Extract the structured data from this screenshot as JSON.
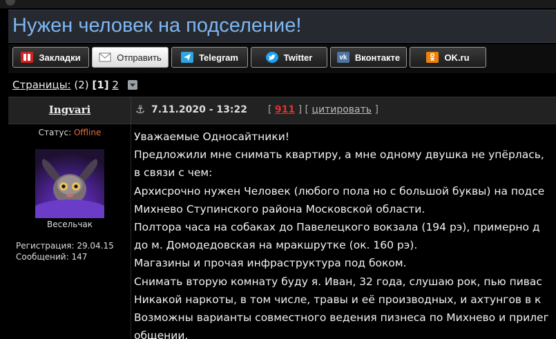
{
  "thread": {
    "title": "Нужен человек на подселение!"
  },
  "share": {
    "buttons": [
      {
        "label": "Закладки",
        "icon": "bookmark-icon",
        "color": "#d42020"
      },
      {
        "label": "Отправить",
        "icon": "envelope-icon",
        "color": "#ffffff"
      },
      {
        "label": "Telegram",
        "icon": "telegram-icon",
        "color": "#2ca5e0"
      },
      {
        "label": "Twitter",
        "icon": "twitter-icon",
        "color": "#1da1f2"
      },
      {
        "label": "Вконтакте",
        "icon": "vk-icon",
        "color": "#4c75a3"
      },
      {
        "label": "OK.ru",
        "icon": "odnoklassniki-icon",
        "color": "#ee8208"
      }
    ]
  },
  "pagination": {
    "label": "Страницы:",
    "count": "(2)",
    "current": "[1]",
    "next": "2"
  },
  "post": {
    "author": "Ingvari",
    "date": "7.11.2020 - 13:22",
    "number": "911",
    "quote_label": "цитировать",
    "status_label": "Статус:",
    "status_value": "Offline",
    "status_color": "#e0703a",
    "rank": "Весельчак",
    "registration": "Регистрация: 29.04.15",
    "messages": "Сообщений: 147",
    "body": [
      "Уважаемые Односайтники!",
      "Предложили мне снимать квартиру, а мне одному двушка не упёрлась,",
      "в связи с чем:",
      "Архисрочно нужен Человек (любого пола но с большой буквы) на подсе",
      "Михнево Ступинского района Московской области.",
      "Полтора часа на собаках до Павелецкого вокзала (194 рэ), примерно д",
      "до м. Домодедовская на мракшрутке (ок. 160 рэ).",
      "Магазины и прочая инфраструктура под боком.",
      "Снимать вторую комнату буду я. Иван, 32 года, слушаю рок, пью пивас",
      "Никакой наркоты, в том числе, травы и её производных, и ахтунгов в к",
      "Возможны варианты совместного ведения пизнеса по Михнево и прилег",
      "общении."
    ]
  }
}
